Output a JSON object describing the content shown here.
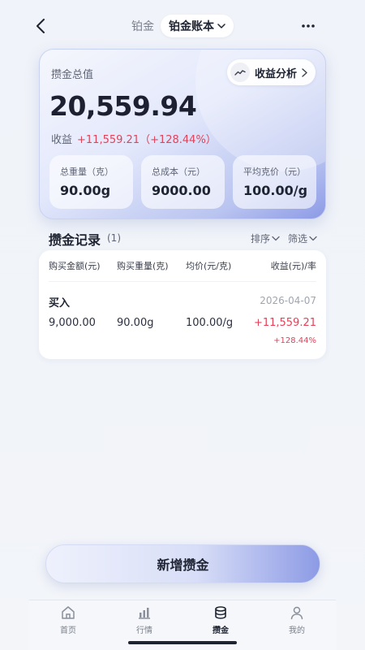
{
  "header": {
    "category": "铂金",
    "book_title": "铂金账本"
  },
  "summary": {
    "title": "攒金总值",
    "total_value": "20,559.94",
    "analysis_label": "收益分析",
    "profit_label": "收益",
    "profit_value": "+11,559.21（+128.44%）",
    "stats": [
      {
        "label": "总重量（克）",
        "value": "90.00g"
      },
      {
        "label": "总成本（元）",
        "value": "9000.00"
      },
      {
        "label": "平均克价（元）",
        "value": "100.00/g"
      }
    ]
  },
  "records": {
    "title": "攒金记录",
    "count": "(1)",
    "sort_label": "排序",
    "filter_label": "筛选",
    "columns": [
      "购买金额(元)",
      "购买重量(克)",
      "均价(元/克)",
      "收益(元)/率"
    ],
    "rows": [
      {
        "type": "买入",
        "date": "2026-04-07",
        "amount": "9,000.00",
        "weight": "90.00g",
        "avg_price": "100.00/g",
        "profit": "+11,559.21",
        "rate": "+128.44%"
      }
    ]
  },
  "add_button": "新增攒金",
  "nav": [
    {
      "label": "首页",
      "icon": "home-icon"
    },
    {
      "label": "行情",
      "icon": "chart-icon"
    },
    {
      "label": "攒金",
      "icon": "coins-icon",
      "active": true
    },
    {
      "label": "我的",
      "icon": "user-icon"
    }
  ],
  "colors": {
    "profit": "#e0435a",
    "accent": "#8c9ae6"
  }
}
